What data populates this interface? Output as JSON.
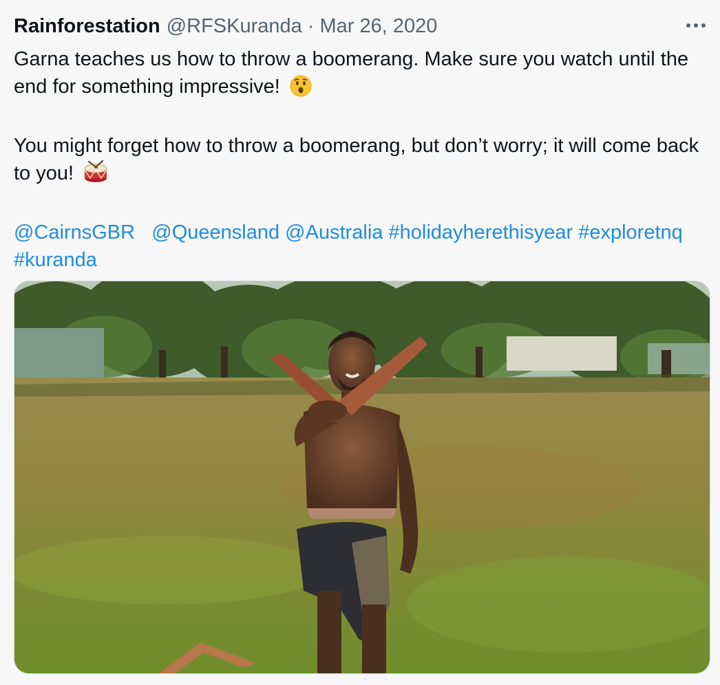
{
  "tweet": {
    "author": {
      "display_name": "Rainforestation",
      "handle": "@RFSKuranda"
    },
    "separator": "·",
    "date": "Mar 26, 2020",
    "more_icon": "more-icon",
    "paragraph1": {
      "text": "Garna teaches us how to throw a boomerang. Make sure you watch until the end for something impressive!",
      "emoji": "astonished-face-emoji"
    },
    "paragraph2": {
      "text": "You might forget how to throw a boomerang, but don’t worry; it will come back to you!",
      "emoji": "drum-emoji"
    },
    "tags": {
      "mention1": "@CairnsGBR",
      "mention2": "@Queensland",
      "mention3": "@Australia",
      "hashtag1": "#holidayherethisyear",
      "hashtag2": "#exploretnq",
      "hashtag3": "#kuranda"
    },
    "media": {
      "kind": "video-thumbnail",
      "subject": "man holding boomerang in grassy field"
    }
  },
  "colors": {
    "text": "#0f1419",
    "secondary": "#536471",
    "link": "#1d8ce0",
    "background": "#f7f7f7"
  }
}
